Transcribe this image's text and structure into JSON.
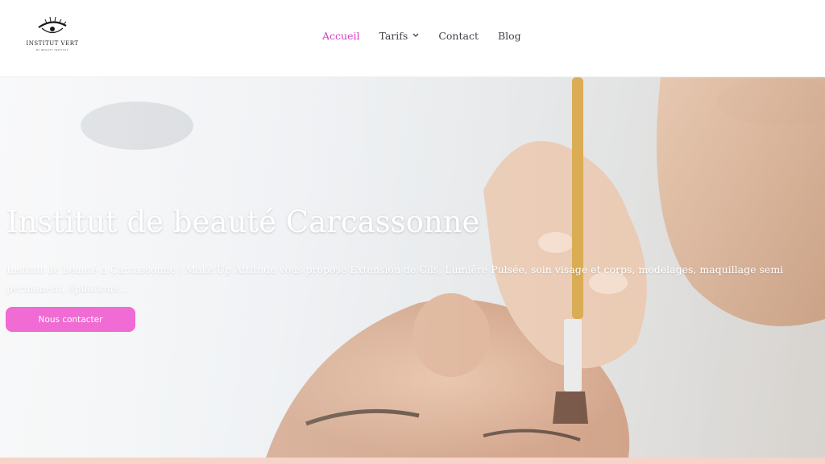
{
  "header": {
    "logo": {
      "title": "INSTITUT VERT",
      "subtitle": "BY BEAUTY INSTITUT",
      "icon": "eyelash-icon"
    },
    "nav": [
      {
        "label": "Accueil",
        "active": true
      },
      {
        "label": "Tarifs",
        "has_dropdown": true,
        "icon": "chevron-down-icon"
      },
      {
        "label": "Contact"
      },
      {
        "label": "Blog"
      }
    ]
  },
  "hero": {
    "title": "Institut de beauté Carcassonne",
    "description": "Institut de beauté a Carcassonne | Make'Up Attitude vous propose Extension de Cils, Lumière Pulsée, soin visage et corps, modelages, maquillage semi permanent, épilations,..",
    "button_label": "Nous contacter",
    "image": "makeup-brush-face-photo"
  },
  "colors": {
    "accent": "#d63bc4",
    "button": "#f06bd3",
    "strip": "#f7d3c9"
  }
}
